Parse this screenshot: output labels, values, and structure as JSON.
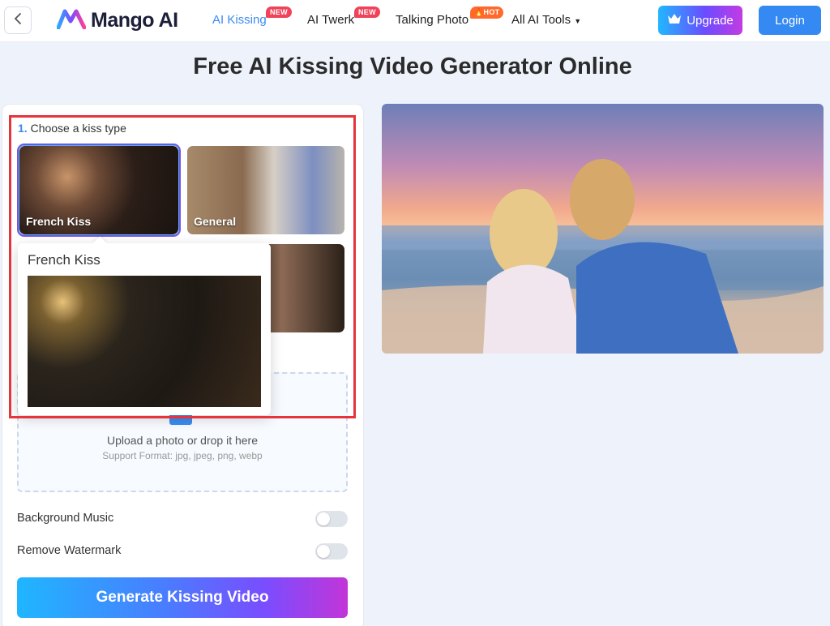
{
  "header": {
    "logo_text": "Mango AI",
    "nav": [
      {
        "label": "AI Kissing",
        "badge": "NEW"
      },
      {
        "label": "AI Twerk",
        "badge": "NEW"
      },
      {
        "label": "Talking Photo",
        "badge": "HOT"
      },
      {
        "label": "All AI Tools"
      }
    ],
    "upgrade_label": "Upgrade",
    "login_label": "Login"
  },
  "page_title": "Free AI Kissing Video Generator Online",
  "step1": {
    "num": "1.",
    "label": "Choose a kiss type"
  },
  "kiss_types": [
    {
      "label": "French Kiss"
    },
    {
      "label": "General"
    }
  ],
  "tooltip": {
    "title": "French Kiss"
  },
  "upload": {
    "text": "Upload a photo or drop it here",
    "sub": "Support Format: jpg, jpeg, png, webp"
  },
  "options": [
    {
      "label": "Background Music",
      "enabled": false
    },
    {
      "label": "Remove Watermark",
      "enabled": false
    }
  ],
  "generate_label": "Generate Kissing Video",
  "colors": {
    "accent": "#3b8cf0",
    "highlight": "#e5343b"
  }
}
